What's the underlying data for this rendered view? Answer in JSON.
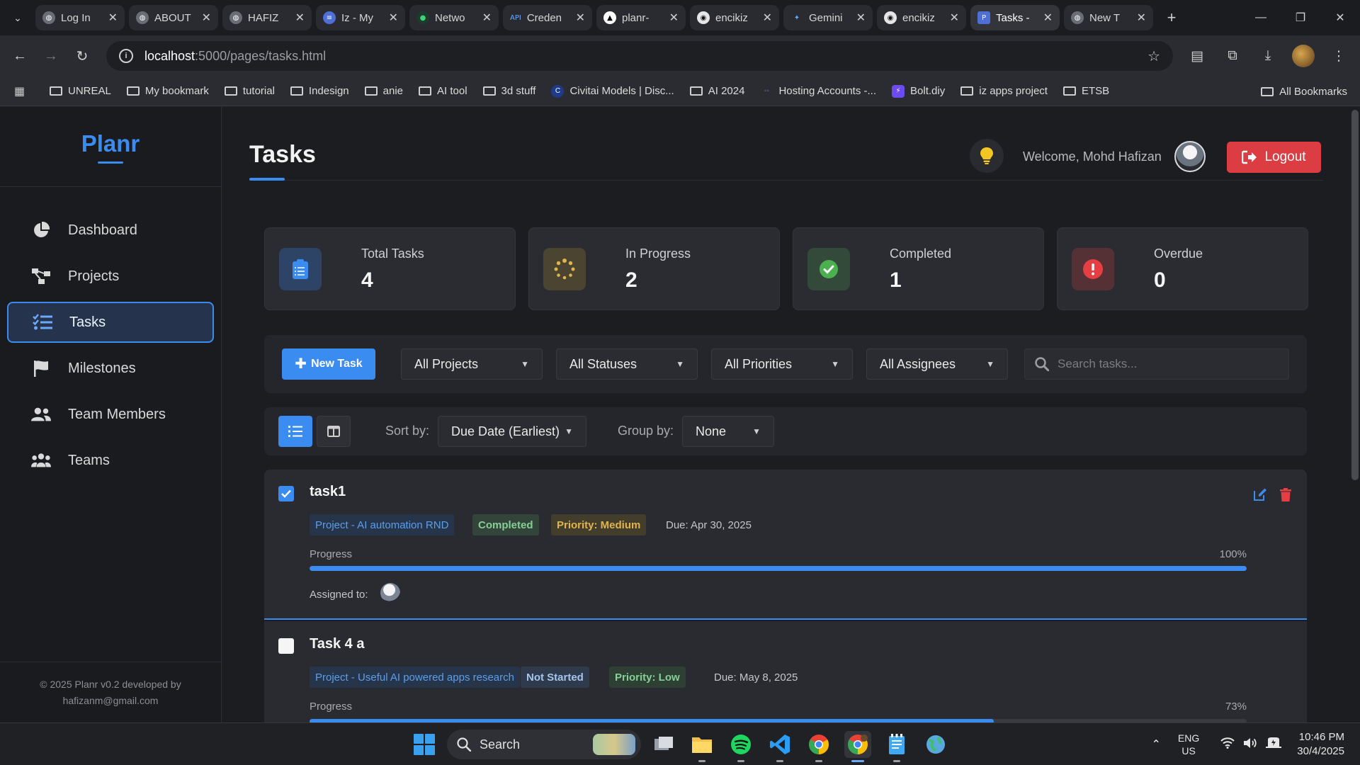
{
  "browser": {
    "tabs": [
      {
        "title": "Log In",
        "icon": "globe-icon",
        "active": false
      },
      {
        "title": "ABOUT",
        "icon": "globe-icon",
        "active": false
      },
      {
        "title": "HAFIZ",
        "icon": "globe-icon",
        "active": false
      },
      {
        "title": "Iz - My",
        "icon": "doc-icon",
        "active": false
      },
      {
        "title": "Netwo",
        "icon": "leaf-icon",
        "active": false
      },
      {
        "title": "Creden",
        "icon": "api-icon",
        "active": false
      },
      {
        "title": "planr-",
        "icon": "triangle-icon",
        "active": false
      },
      {
        "title": "encikiz",
        "icon": "github-icon",
        "active": false
      },
      {
        "title": "Gemini",
        "icon": "sparkle-icon",
        "active": false
      },
      {
        "title": "encikiz",
        "icon": "github-icon",
        "active": false
      },
      {
        "title": "Tasks -",
        "icon": "planr-icon",
        "active": true
      },
      {
        "title": "New T",
        "icon": "chrome-icon",
        "active": false
      }
    ],
    "address": {
      "host": "localhost",
      "path": ":5000/pages/tasks.html"
    },
    "bookmarks": [
      {
        "label": "UNREAL",
        "icon": "folder-icon"
      },
      {
        "label": "My bookmark",
        "icon": "folder-icon"
      },
      {
        "label": "tutorial",
        "icon": "folder-icon"
      },
      {
        "label": "Indesign",
        "icon": "folder-icon"
      },
      {
        "label": "anie",
        "icon": "folder-icon"
      },
      {
        "label": "AI tool",
        "icon": "folder-icon"
      },
      {
        "label": "3d stuff",
        "icon": "folder-icon"
      },
      {
        "label": "Civitai Models | Disc...",
        "icon": "civitai-icon"
      },
      {
        "label": "AI 2024",
        "icon": "folder-icon"
      },
      {
        "label": "Hosting Accounts -...",
        "icon": "hosting-icon"
      },
      {
        "label": "Bolt.diy",
        "icon": "bolt-icon"
      },
      {
        "label": "iz apps project",
        "icon": "folder-icon"
      },
      {
        "label": "ETSB",
        "icon": "folder-icon"
      }
    ],
    "all_bookmarks": "All Bookmarks"
  },
  "sidebar": {
    "brand": "Planr",
    "items": [
      {
        "label": "Dashboard",
        "icon": "pie-chart-icon",
        "active": false
      },
      {
        "label": "Projects",
        "icon": "project-diagram-icon",
        "active": false
      },
      {
        "label": "Tasks",
        "icon": "tasks-list-icon",
        "active": true
      },
      {
        "label": "Milestones",
        "icon": "flag-icon",
        "active": false
      },
      {
        "label": "Team Members",
        "icon": "users-icon",
        "active": false
      },
      {
        "label": "Teams",
        "icon": "team-group-icon",
        "active": false
      }
    ],
    "footer_line1": "© 2025 Planr v0.2 developed by",
    "footer_line2": "hafizanm@gmail.com"
  },
  "header": {
    "title": "Tasks",
    "welcome": "Welcome, Mohd Hafizan",
    "logout_label": "Logout"
  },
  "stats": [
    {
      "label": "Total Tasks",
      "value": "4",
      "icon": "clipboard-icon",
      "color": "#3b8cf0"
    },
    {
      "label": "In Progress",
      "value": "2",
      "icon": "spinner-icon",
      "color": "#e0b54b"
    },
    {
      "label": "Completed",
      "value": "1",
      "icon": "check-circle-icon",
      "color": "#4caf50"
    },
    {
      "label": "Overdue",
      "value": "0",
      "icon": "exclamation-circle-icon",
      "color": "#dc3d42"
    }
  ],
  "filters": {
    "new_task_label": "New Task",
    "project": "All Projects",
    "status": "All Statuses",
    "priority": "All Priorities",
    "assignee": "All Assignees",
    "search_placeholder": "Search tasks..."
  },
  "view": {
    "sort_label": "Sort by:",
    "sort_value": "Due Date (Earliest)",
    "group_label": "Group by:",
    "group_value": "None"
  },
  "tasks": [
    {
      "title": "task1",
      "checked": true,
      "project": "Project - AI automation RND",
      "status": "Completed",
      "priority": "Priority: Medium",
      "due": "Due: Apr 30, 2025",
      "progress_label": "Progress",
      "progress_text": "100%",
      "progress": 100,
      "assigned_label": "Assigned to:"
    },
    {
      "title": "Task 4 a",
      "checked": false,
      "project": "Project - Useful AI powered apps research",
      "status": "Not Started",
      "priority": "Priority: Low",
      "due": "Due: May 8, 2025",
      "progress_label": "Progress",
      "progress_text": "73%",
      "progress": 73
    }
  ],
  "taskbar": {
    "search_label": "Search",
    "lang": "ENG",
    "region": "US",
    "time": "10:46 PM",
    "date": "30/4/2025"
  },
  "colors": {
    "accent": "#3b8cf0",
    "danger": "#dc3d42",
    "bg": "#1c1d21"
  }
}
